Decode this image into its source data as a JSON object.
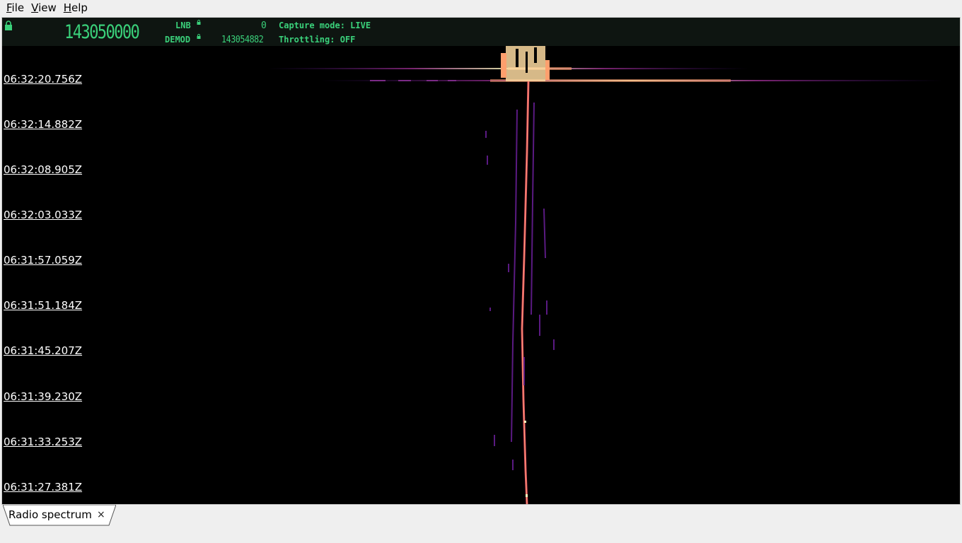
{
  "menubar": {
    "items": [
      {
        "mnemonic": "F",
        "rest": "ile"
      },
      {
        "mnemonic": "V",
        "rest": "iew"
      },
      {
        "mnemonic": "H",
        "rest": "elp"
      }
    ]
  },
  "header": {
    "frequency_display": "143050000",
    "lnb_label": "LNB",
    "lnb_value": "0",
    "demod_label": "DEMOD",
    "demod_value": "143054882",
    "capture_mode": "Capture mode: LIVE",
    "throttling": "Throttling: OFF",
    "accent_color": "#3ad07a",
    "background_color": "#0e1511"
  },
  "waterfall": {
    "timestamps": [
      "06:32:20.756Z",
      "06:32:14.882Z",
      "06:32:08.905Z",
      "06:32:03.033Z",
      "06:31:57.059Z",
      "06:31:51.184Z",
      "06:31:45.207Z",
      "06:31:39.230Z",
      "06:31:33.253Z",
      "06:31:27.381Z"
    ],
    "colormap": [
      "#000000",
      "#3b0f70",
      "#8c2981",
      "#de4968",
      "#fe9f6d",
      "#fcfdbf"
    ]
  },
  "tabs": [
    {
      "label": "Radio spectrum",
      "close": "×"
    }
  ]
}
